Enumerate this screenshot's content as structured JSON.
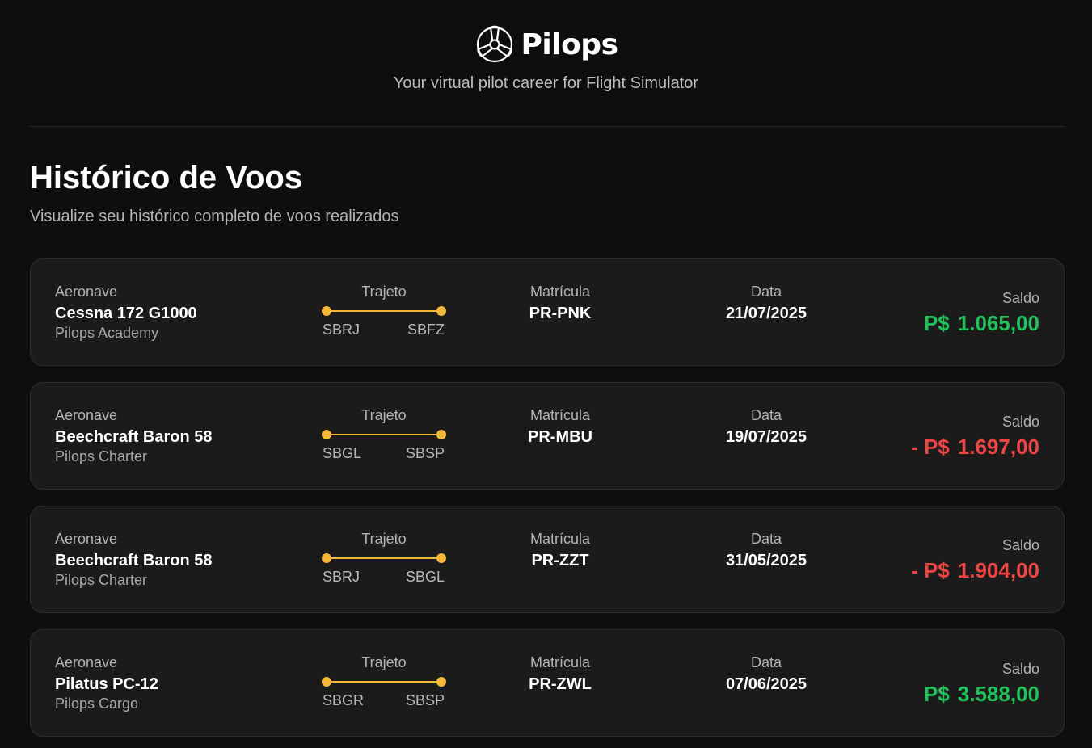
{
  "brand": {
    "name": "Pilops",
    "tagline": "Your virtual pilot career for Flight Simulator"
  },
  "page": {
    "title": "Histórico de Voos",
    "subtitle": "Visualize seu histórico completo de voos realizados"
  },
  "labels": {
    "aircraft": "Aeronave",
    "route": "Trajeto",
    "registration": "Matrícula",
    "date": "Data",
    "balance": "Saldo"
  },
  "colors": {
    "positive": "#22c05a",
    "negative": "#ef4444",
    "route": "#f4b73a"
  },
  "flights": [
    {
      "aircraft": "Cessna 172 G1000",
      "company": "Pilops Academy",
      "from": "SBRJ",
      "to": "SBFZ",
      "registration": "PR-PNK",
      "date": "21/07/2025",
      "balance_sign": "",
      "balance_currency": "P$",
      "balance_amount": "1.065,00",
      "positive": true
    },
    {
      "aircraft": "Beechcraft Baron 58",
      "company": "Pilops Charter",
      "from": "SBGL",
      "to": "SBSP",
      "registration": "PR-MBU",
      "date": "19/07/2025",
      "balance_sign": "- ",
      "balance_currency": "P$",
      "balance_amount": "1.697,00",
      "positive": false
    },
    {
      "aircraft": "Beechcraft Baron 58",
      "company": "Pilops Charter",
      "from": "SBRJ",
      "to": "SBGL",
      "registration": "PR-ZZT",
      "date": "31/05/2025",
      "balance_sign": "- ",
      "balance_currency": "P$",
      "balance_amount": "1.904,00",
      "positive": false
    },
    {
      "aircraft": "Pilatus PC-12",
      "company": "Pilops Cargo",
      "from": "SBGR",
      "to": "SBSP",
      "registration": "PR-ZWL",
      "date": "07/06/2025",
      "balance_sign": "",
      "balance_currency": "P$",
      "balance_amount": "3.588,00",
      "positive": true
    }
  ]
}
